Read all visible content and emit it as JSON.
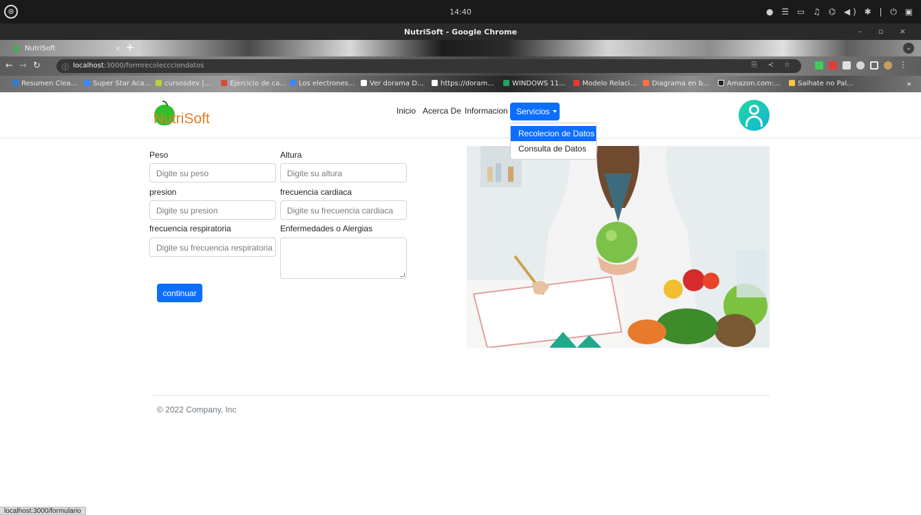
{
  "os": {
    "clock": "14:40",
    "distro_icon": "ubuntu-like-logo",
    "tray_icons": [
      "record-dot-icon",
      "menu-icon",
      "clipboard-icon",
      "bell-icon",
      "network-icon",
      "volume-icon",
      "bluetooth-icon",
      "power-icon",
      "window-icon"
    ]
  },
  "browser": {
    "window_title": "NutriSoft - Google Chrome",
    "tab": {
      "label": "NutriSoft",
      "close": "×"
    },
    "new_tab": "+",
    "url_host": "localhost",
    "url_rest": ":3000/formrecoleccciondatos",
    "bookmarks": [
      {
        "label": "Resumen Clea...",
        "color": "#2f7bd6"
      },
      {
        "label": "Super Star Aca...",
        "color": "#3a86ff"
      },
      {
        "label": "cursosdev |...",
        "color": "#b6d33a"
      },
      {
        "label": "Ejercicio de ca...",
        "color": "#d84a3b"
      },
      {
        "label": "Los electrones...",
        "color": "#4285f4"
      },
      {
        "label": "Ver dorama D...",
        "color": "#ffffff"
      },
      {
        "label": "https://doram...",
        "color": "#ffffff"
      },
      {
        "label": "WINDOWS 11...",
        "color": "#1fa463"
      },
      {
        "label": "Modelo Relaci...",
        "color": "#e53935"
      },
      {
        "label": "Diagrama en b...",
        "color": "#ff7043"
      },
      {
        "label": "Amazon.com:...",
        "color": "#222222"
      },
      {
        "label": "Saihate no Pal...",
        "color": "#f4c542"
      }
    ],
    "more_bookmarks": "»",
    "status_url": "localhost:3000/formulario"
  },
  "site": {
    "logo_text": "NutriSoft",
    "nav": {
      "inicio": "Inicio",
      "acerca": "Acerca De",
      "informacion": "Informacion",
      "servicios": "Servicios"
    },
    "dropdown": {
      "items": [
        "Recolecion de Datos",
        "Consulta de Datos"
      ],
      "active_index": 0
    },
    "form": {
      "peso_label": "Peso",
      "peso_placeholder": "Digite su peso",
      "altura_label": "Altura",
      "altura_placeholder": "Digite su altura",
      "presion_label": "presion",
      "presion_placeholder": "Digite su presion",
      "fc_label": "frecuencia cardiaca",
      "fc_placeholder": "Digite su frecuencia cardiaca",
      "fr_label": "frecuencia respiratoria",
      "fr_placeholder": "Digite su frecuencia respiratoria",
      "alergias_label": "Enfermedades o Alergias",
      "submit": "continuar"
    },
    "footer": "© 2022 Company, Inc",
    "accent_color": "#0d6efd"
  }
}
